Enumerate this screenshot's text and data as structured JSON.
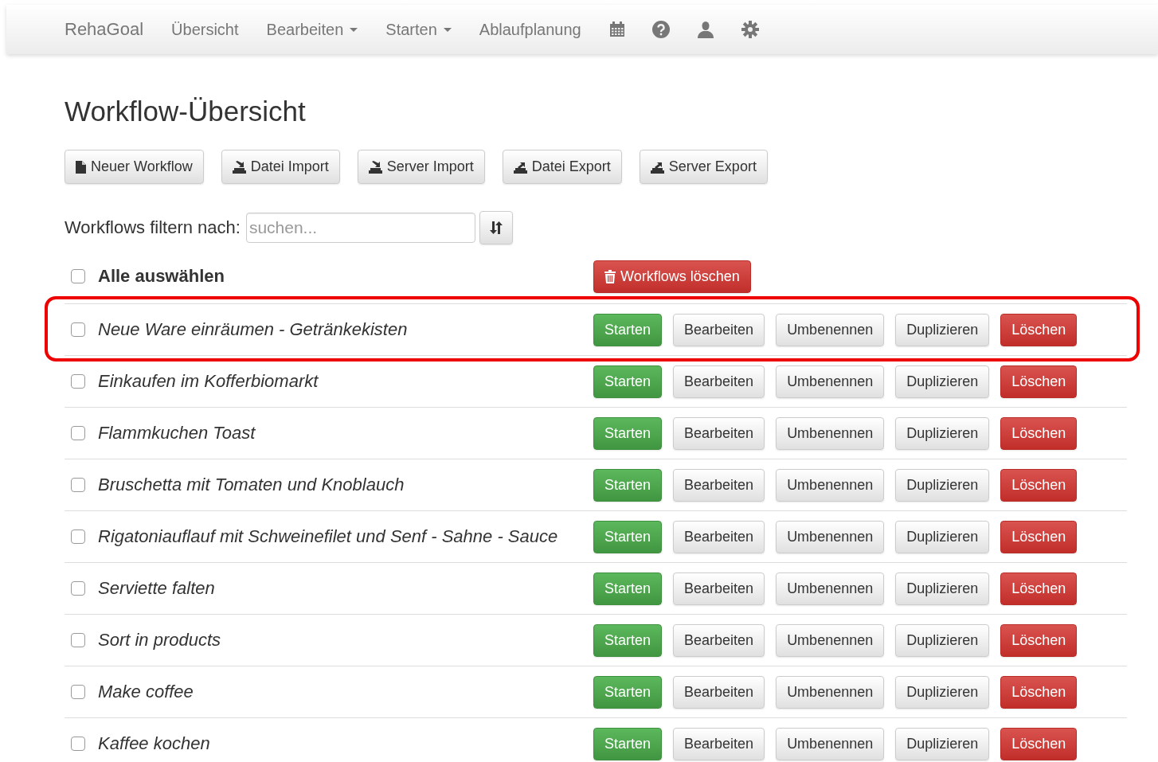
{
  "navbar": {
    "brand": "RehaGoal",
    "items": [
      {
        "label": "Übersicht",
        "dropdown": false
      },
      {
        "label": "Bearbeiten",
        "dropdown": true
      },
      {
        "label": "Starten",
        "dropdown": true
      },
      {
        "label": "Ablaufplanung",
        "dropdown": false
      }
    ],
    "icons": [
      {
        "kind": "calendar"
      },
      {
        "kind": "help"
      },
      {
        "kind": "user"
      },
      {
        "kind": "settings"
      }
    ]
  },
  "title": "Workflow-Übersicht",
  "toolbar": [
    {
      "label": "Neuer Workflow",
      "kind": "file"
    },
    {
      "label": "Datei Import",
      "kind": "import"
    },
    {
      "label": "Server Import",
      "kind": "import"
    },
    {
      "label": "Datei Export",
      "kind": "export"
    },
    {
      "label": "Server Export",
      "kind": "export"
    }
  ],
  "filter": {
    "label": "Workflows filtern nach:",
    "placeholder": "suchen..."
  },
  "select_all": {
    "label": "Alle auswählen",
    "checked": false
  },
  "delete_selected": "Workflows löschen",
  "workflows": [
    {
      "name": "Neue Ware einräumen - Getränkekisten",
      "checked": false,
      "highlighted": true,
      "actions": [
        {
          "label": "Starten",
          "kind": "success"
        },
        {
          "label": "Bearbeiten",
          "kind": "default"
        },
        {
          "label": "Umbenennen",
          "kind": "default"
        },
        {
          "label": "Duplizieren",
          "kind": "default"
        },
        {
          "label": "Löschen",
          "kind": "danger"
        }
      ]
    },
    {
      "name": "Einkaufen im Kofferbiomarkt",
      "checked": false,
      "highlighted": false,
      "actions": [
        {
          "label": "Starten",
          "kind": "success"
        },
        {
          "label": "Bearbeiten",
          "kind": "default"
        },
        {
          "label": "Umbenennen",
          "kind": "default"
        },
        {
          "label": "Duplizieren",
          "kind": "default"
        },
        {
          "label": "Löschen",
          "kind": "danger"
        }
      ]
    },
    {
      "name": "Flammkuchen Toast",
      "checked": false,
      "highlighted": false,
      "actions": [
        {
          "label": "Starten",
          "kind": "success"
        },
        {
          "label": "Bearbeiten",
          "kind": "default"
        },
        {
          "label": "Umbenennen",
          "kind": "default"
        },
        {
          "label": "Duplizieren",
          "kind": "default"
        },
        {
          "label": "Löschen",
          "kind": "danger"
        }
      ]
    },
    {
      "name": "Bruschetta mit Tomaten und Knoblauch",
      "checked": false,
      "highlighted": false,
      "actions": [
        {
          "label": "Starten",
          "kind": "success"
        },
        {
          "label": "Bearbeiten",
          "kind": "default"
        },
        {
          "label": "Umbenennen",
          "kind": "default"
        },
        {
          "label": "Duplizieren",
          "kind": "default"
        },
        {
          "label": "Löschen",
          "kind": "danger"
        }
      ]
    },
    {
      "name": "Rigatoniauflauf mit Schweinefilet und Senf - Sahne - Sauce",
      "checked": false,
      "highlighted": false,
      "actions": [
        {
          "label": "Starten",
          "kind": "success"
        },
        {
          "label": "Bearbeiten",
          "kind": "default"
        },
        {
          "label": "Umbenennen",
          "kind": "default"
        },
        {
          "label": "Duplizieren",
          "kind": "default"
        },
        {
          "label": "Löschen",
          "kind": "danger"
        }
      ]
    },
    {
      "name": "Serviette falten",
      "checked": false,
      "highlighted": false,
      "actions": [
        {
          "label": "Starten",
          "kind": "success"
        },
        {
          "label": "Bearbeiten",
          "kind": "default"
        },
        {
          "label": "Umbenennen",
          "kind": "default"
        },
        {
          "label": "Duplizieren",
          "kind": "default"
        },
        {
          "label": "Löschen",
          "kind": "danger"
        }
      ]
    },
    {
      "name": "Sort in products",
      "checked": false,
      "highlighted": false,
      "actions": [
        {
          "label": "Starten",
          "kind": "success"
        },
        {
          "label": "Bearbeiten",
          "kind": "default"
        },
        {
          "label": "Umbenennen",
          "kind": "default"
        },
        {
          "label": "Duplizieren",
          "kind": "default"
        },
        {
          "label": "Löschen",
          "kind": "danger"
        }
      ]
    },
    {
      "name": "Make coffee",
      "checked": false,
      "highlighted": false,
      "actions": [
        {
          "label": "Starten",
          "kind": "success"
        },
        {
          "label": "Bearbeiten",
          "kind": "default"
        },
        {
          "label": "Umbenennen",
          "kind": "default"
        },
        {
          "label": "Duplizieren",
          "kind": "default"
        },
        {
          "label": "Löschen",
          "kind": "danger"
        }
      ]
    },
    {
      "name": "Kaffee kochen",
      "checked": false,
      "highlighted": false,
      "actions": [
        {
          "label": "Starten",
          "kind": "success"
        },
        {
          "label": "Bearbeiten",
          "kind": "default"
        },
        {
          "label": "Umbenennen",
          "kind": "default"
        },
        {
          "label": "Duplizieren",
          "kind": "default"
        },
        {
          "label": "Löschen",
          "kind": "danger"
        }
      ]
    }
  ]
}
